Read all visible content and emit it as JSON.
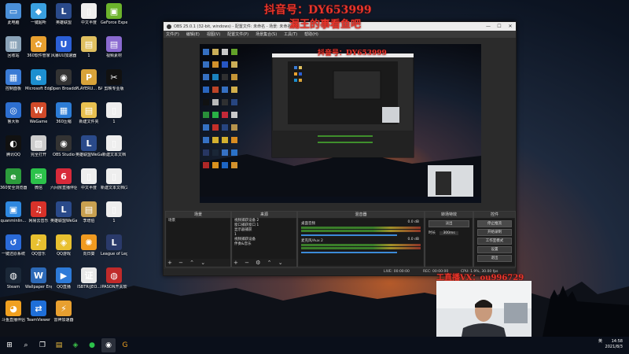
{
  "overlays": {
    "douyin_top": "抖音号：DY653999",
    "slogan": "漏王的事看鱼吧",
    "wechat": "工直播VX：ou996729"
  },
  "desktop_icons": [
    {
      "label": "此电脑",
      "color": "#4a8fd8",
      "glyph": "▭"
    },
    {
      "label": "一键超听",
      "color": "#3aa0e0",
      "glyph": "◆"
    },
    {
      "label": "英雄联盟",
      "color": "#2a4a8a",
      "glyph": "L"
    },
    {
      "label": "中文半度",
      "color": "#eeeeee",
      "glyph": "▯"
    },
    {
      "label": "GeForce Experience",
      "color": "#6cb32c",
      "glyph": "▣"
    },
    {
      "label": "回收站",
      "color": "#8aa3b8",
      "glyph": "▥"
    },
    {
      "label": "360软件管家",
      "color": "#e8a030",
      "glyph": "✿"
    },
    {
      "label": "风暴UU加速器",
      "color": "#2b5fd6",
      "glyph": "U"
    },
    {
      "label": "1",
      "color": "#e0c060",
      "glyph": "▤"
    },
    {
      "label": "视频素材",
      "color": "#8a6ad0",
      "glyph": "▤"
    },
    {
      "label": "控制面板",
      "color": "#3a7bd5",
      "glyph": "▦"
    },
    {
      "label": "Microsoft Edge",
      "color": "#1d8fd0",
      "glyph": "e"
    },
    {
      "label": "Open Broadcast...",
      "color": "#333333",
      "glyph": "◉"
    },
    {
      "label": "PLAYERU... BATTLEGR...",
      "color": "#d8a33a",
      "glyph": "P"
    },
    {
      "label": "剪映专业版",
      "color": "#111111",
      "glyph": "✂"
    },
    {
      "label": "鲁大师",
      "color": "#2d6fd0",
      "glyph": "◎"
    },
    {
      "label": "WeGame",
      "color": "#d04a2a",
      "glyph": "W"
    },
    {
      "label": "360压缩",
      "color": "#2c7cd6",
      "glyph": "▦"
    },
    {
      "label": "新建文件夹",
      "color": "#e8c050",
      "glyph": "▤"
    },
    {
      "label": "1",
      "color": "#eeeeee",
      "glyph": "▯"
    },
    {
      "label": "腾讯QQ",
      "color": "#111111",
      "glyph": "◐"
    },
    {
      "label": "完全打开",
      "color": "#cccccc",
      "glyph": "▧"
    },
    {
      "label": "OBS Studio",
      "color": "#333333",
      "glyph": "◉"
    },
    {
      "label": "英雄联盟WeGame版",
      "color": "#2a4a8a",
      "glyph": "L"
    },
    {
      "label": "新建文本文档",
      "color": "#eeeeee",
      "glyph": "▯"
    },
    {
      "label": "360安全浏览器",
      "color": "#2c9c3c",
      "glyph": "e"
    },
    {
      "label": "微信",
      "color": "#2cc24a",
      "glyph": "✉"
    },
    {
      "label": "六间房直播伴侣",
      "color": "#d82a3a",
      "glyph": "6"
    },
    {
      "label": "中文半度",
      "color": "#eeeeee",
      "glyph": "▯"
    },
    {
      "label": "新建文本文档(2)",
      "color": "#eeeeee",
      "glyph": "▯"
    },
    {
      "label": "quanminlin...",
      "color": "#2e88e0",
      "glyph": "▣"
    },
    {
      "label": "网易云音乐",
      "color": "#d8322a",
      "glyph": "♫"
    },
    {
      "label": "英雄联盟WeGame版",
      "color": "#2a4a8a",
      "glyph": "L"
    },
    {
      "label": "李增伯",
      "color": "#c8a050",
      "glyph": "▤"
    },
    {
      "label": "1",
      "color": "#eeeeee",
      "glyph": "▯"
    },
    {
      "label": "一键还原系统",
      "color": "#2a6ad8",
      "glyph": "↺"
    },
    {
      "label": "QQ音乐",
      "color": "#e8c030",
      "glyph": "♪"
    },
    {
      "label": "QQ游戏",
      "color": "#e8c030",
      "glyph": "◈"
    },
    {
      "label": "向日葵",
      "color": "#f09a20",
      "glyph": "✺"
    },
    {
      "label": "League of Legends",
      "color": "#2a3a6a",
      "glyph": "L"
    },
    {
      "label": "Steam",
      "color": "#1b2838",
      "glyph": "◍"
    },
    {
      "label": "Wallpaper Engine",
      "color": "#2d6ab8",
      "glyph": "W"
    },
    {
      "label": "QQ直播",
      "color": "#2d7ad8",
      "glyph": "▶"
    },
    {
      "label": "ISBTR(JEO...",
      "color": "#e8e8e8",
      "glyph": "证"
    },
    {
      "label": "IPASON开关软件",
      "color": "#c02a2a",
      "glyph": "◍"
    },
    {
      "label": "斗鱼直播伴侣",
      "color": "#f0a020",
      "glyph": "◕"
    },
    {
      "label": "TeamViewer",
      "color": "#1f6fd8",
      "glyph": "⇄"
    },
    {
      "label": "雷神加速器",
      "color": "#e8a030",
      "glyph": "⚡"
    }
  ],
  "obs": {
    "title": "OBS 25.0.1 (32-bit, windows) - 配置文件: 未命名 - 场景: 未命名",
    "menu": [
      "文件(F)",
      "编辑(E)",
      "视图(V)",
      "配置文件(P)",
      "场景集合(S)",
      "工具(T)",
      "帮助(H)"
    ],
    "panels": {
      "scenes": {
        "title": "场景",
        "items": [
          "场景"
        ]
      },
      "sources": {
        "title": "来源",
        "items": [
          "视频捕获设备 2",
          "窗口捕获窗口 1",
          "显示器捕获",
          "1",
          "视频捕获设备",
          "伴奏&音乐"
        ]
      },
      "mixer": {
        "title": "混音器",
        "channels": [
          {
            "name": "桌面音频",
            "db": "0.0 dB"
          },
          {
            "name": "麦克风/Aux 2",
            "db": "0.0 dB"
          }
        ]
      },
      "transitions": {
        "title": "转场特效",
        "type": "淡出",
        "duration_label": "时长",
        "duration": "300ms"
      },
      "controls": {
        "title": "控件",
        "buttons": [
          "停止推流",
          "开始录制",
          "工作室模式",
          "设置",
          "退出"
        ]
      }
    },
    "status": {
      "live": "LIVE: 00:00:00",
      "rec": "REC: 00:00:00",
      "cpu": "CPU: 1.9%, 30.00 fps"
    }
  },
  "taskbar": {
    "time": "14:58",
    "date": "2021/8/3",
    "lang": "英"
  }
}
